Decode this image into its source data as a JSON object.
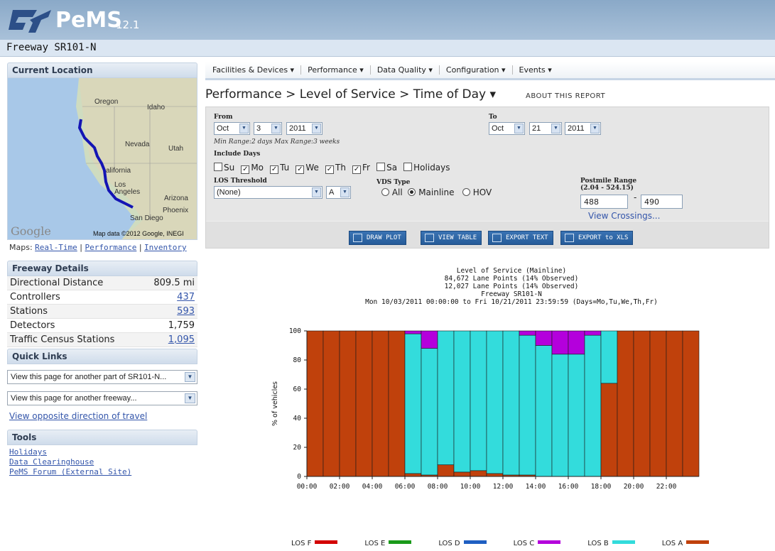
{
  "top_caption": "Level of Service (Mainline)",
  "header": {
    "brand": "PeMS",
    "version": "12.1",
    "subtitle": "Freeway SR101-N"
  },
  "left": {
    "current_location": "Current Location",
    "map": {
      "labels": [
        "Oregon",
        "Idaho",
        "Nevada",
        "Utah",
        "alifornia",
        "Los\nAngeles",
        "Arizona",
        "Phoenix",
        "San Diego"
      ],
      "logo": "Google",
      "attribution": "Map data ©2012 Google, INEGI"
    },
    "maps_prefix": "Maps:",
    "maps_links": [
      "Real-Time",
      "Performance",
      "Inventory"
    ],
    "freeway_details_title": "Freeway Details",
    "details": [
      {
        "label": "Directional Distance",
        "value": "809.5 mi"
      },
      {
        "label": "Controllers",
        "value": "437"
      },
      {
        "label": "Stations",
        "value": "593"
      },
      {
        "label": "Detectors",
        "value": "1,759"
      },
      {
        "label": "Traffic Census Stations",
        "value": "1,095"
      }
    ],
    "quick_links_title": "Quick Links",
    "select1": "View this page for another part of SR101-N...",
    "select2": "View this page for another freeway...",
    "opposite_link": "View opposite direction of travel",
    "tools_title": "Tools",
    "tools_links": [
      "Holidays",
      "Data Clearinghouse",
      "PeMS Forum (External Site)"
    ]
  },
  "menu": [
    "Facilities & Devices ▾",
    "Performance ▾",
    "Data Quality ▾",
    "Configuration ▾",
    "Events ▾"
  ],
  "report_title": "Performance > Level of Service > Time of Day  ▾",
  "about_report": "ABOUT THIS REPORT",
  "form": {
    "from_label": "From",
    "from_month": "Oct",
    "from_day": "3",
    "from_year": "2011",
    "to_label": "To",
    "to_month": "Oct",
    "to_day": "21",
    "to_year": "2011",
    "range_hint": "Min Range:2 days Max Range:3 weeks",
    "include_days_label": "Include Days",
    "days": [
      {
        "label": "Su",
        "checked": false
      },
      {
        "label": "Mo",
        "checked": true
      },
      {
        "label": "Tu",
        "checked": true
      },
      {
        "label": "We",
        "checked": true
      },
      {
        "label": "Th",
        "checked": true
      },
      {
        "label": "Fr",
        "checked": true
      },
      {
        "label": "Sa",
        "checked": false
      },
      {
        "label": "Holidays",
        "checked": false
      }
    ],
    "los_threshold_label": "LOS Threshold",
    "los_threshold_value": "(None)",
    "los_grade": "A",
    "vds_type_label": "VDS Type",
    "vds_options": [
      "All",
      "Mainline",
      "HOV"
    ],
    "vds_selected": "Mainline",
    "postmile_label": "Postmile Range",
    "postmile_range": "(2.04 - 524.15)",
    "postmile_from": "488",
    "postmile_to": "490",
    "view_crossings": "View Crossings...",
    "buttons": [
      "DRAW PLOT",
      "VIEW TABLE",
      "EXPORT TEXT",
      "EXPORT to XLS"
    ]
  },
  "chart_head": [
    "Level of Service (Mainline)",
    "84,672 Lane Points (14% Observed)",
    "12,027 Lane Points (14% Observed)",
    "Freeway SR101-N",
    "Mon 10/03/2011 00:00:00 to Fri 10/21/2011 23:59:59 (Days=Mo,Tu,We,Th,Fr)"
  ],
  "chart_data": {
    "type": "bar",
    "stacked": true,
    "title": "Level of Service (Mainline)",
    "ylabel": "% of vehicles",
    "ylim": [
      0,
      100
    ],
    "yticks": [
      0,
      20,
      40,
      60,
      80,
      100
    ],
    "xticks": [
      "00:00",
      "02:00",
      "04:00",
      "06:00",
      "08:00",
      "10:00",
      "12:00",
      "14:00",
      "16:00",
      "18:00",
      "20:00",
      "22:00"
    ],
    "categories": [
      "00",
      "01",
      "02",
      "03",
      "04",
      "05",
      "06",
      "07",
      "08",
      "09",
      "10",
      "11",
      "12",
      "13",
      "14",
      "15",
      "16",
      "17",
      "18",
      "19",
      "20",
      "21",
      "22",
      "23"
    ],
    "series": [
      {
        "name": "LOS A",
        "color": "#c0410c",
        "values": [
          100,
          100,
          100,
          100,
          100,
          100,
          2,
          1,
          8,
          3,
          4,
          2,
          1,
          1,
          0,
          0,
          0,
          0,
          64,
          100,
          100,
          100,
          100,
          100
        ]
      },
      {
        "name": "LOS B",
        "color": "#33dcdc",
        "values": [
          0,
          0,
          0,
          0,
          0,
          0,
          96,
          87,
          92,
          97,
          96,
          98,
          99,
          96,
          90,
          84,
          84,
          97,
          36,
          0,
          0,
          0,
          0,
          0
        ]
      },
      {
        "name": "LOS C",
        "color": "#b400dc",
        "values": [
          0,
          0,
          0,
          0,
          0,
          0,
          2,
          12,
          0,
          0,
          0,
          0,
          0,
          3,
          10,
          16,
          16,
          3,
          0,
          0,
          0,
          0,
          0,
          0
        ]
      },
      {
        "name": "LOS D",
        "color": "#1f5fc2",
        "values": [
          0,
          0,
          0,
          0,
          0,
          0,
          0,
          0,
          0,
          0,
          0,
          0,
          0,
          0,
          0,
          0,
          0,
          0,
          0,
          0,
          0,
          0,
          0,
          0
        ]
      },
      {
        "name": "LOS E",
        "color": "#1a9a1a",
        "values": [
          0,
          0,
          0,
          0,
          0,
          0,
          0,
          0,
          0,
          0,
          0,
          0,
          0,
          0,
          0,
          0,
          0,
          0,
          0,
          0,
          0,
          0,
          0,
          0
        ]
      },
      {
        "name": "LOS F",
        "color": "#d30000",
        "values": [
          0,
          0,
          0,
          0,
          0,
          0,
          0,
          0,
          0,
          0,
          0,
          0,
          0,
          0,
          0,
          0,
          0,
          0,
          0,
          0,
          0,
          0,
          0,
          0
        ]
      }
    ],
    "legend": [
      {
        "name": "LOS F",
        "color": "#d30000"
      },
      {
        "name": "LOS E",
        "color": "#1a9a1a"
      },
      {
        "name": "LOS D",
        "color": "#1f5fc2"
      },
      {
        "name": "LOS C",
        "color": "#b400dc"
      },
      {
        "name": "LOS B",
        "color": "#33dcdc"
      },
      {
        "name": "LOS A",
        "color": "#c0410c"
      }
    ]
  }
}
